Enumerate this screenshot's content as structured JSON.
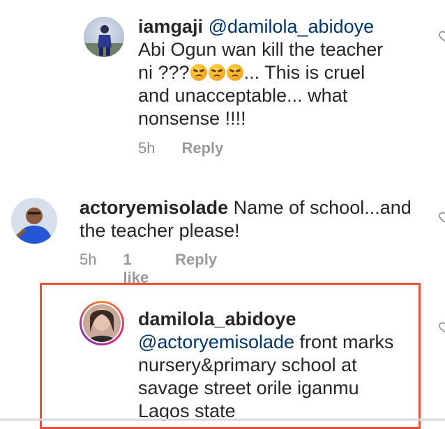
{
  "comments": [
    {
      "username": "iamgaji",
      "mention": "@damilola_abidoye",
      "text_line1": "Abi Ogun wan kill the teacher",
      "text_line2_pre": "ni ???",
      "text_line2_post": "... This is cruel",
      "text_line3": "and unacceptable... what",
      "text_line4": "nonsense !!!!",
      "time": "5h",
      "reply_label": "Reply",
      "emoji": "angry-face"
    },
    {
      "username": "actoryemisolade",
      "text_line1": "Name of school...and",
      "text_line2": "the teacher please!",
      "time": "5h",
      "likes": "1 like",
      "reply_label": "Reply"
    },
    {
      "username": "damilola_abidoye",
      "mention": "@actoryemisolade",
      "text_line1": "front marks",
      "text_line2": "nursery&primary school at",
      "text_line3": "savage street orile iganmu",
      "text_line4": "Lagos state"
    }
  ],
  "colors": {
    "highlight": "#e8503a",
    "mention": "#003569",
    "meta": "#8e8e8e"
  }
}
